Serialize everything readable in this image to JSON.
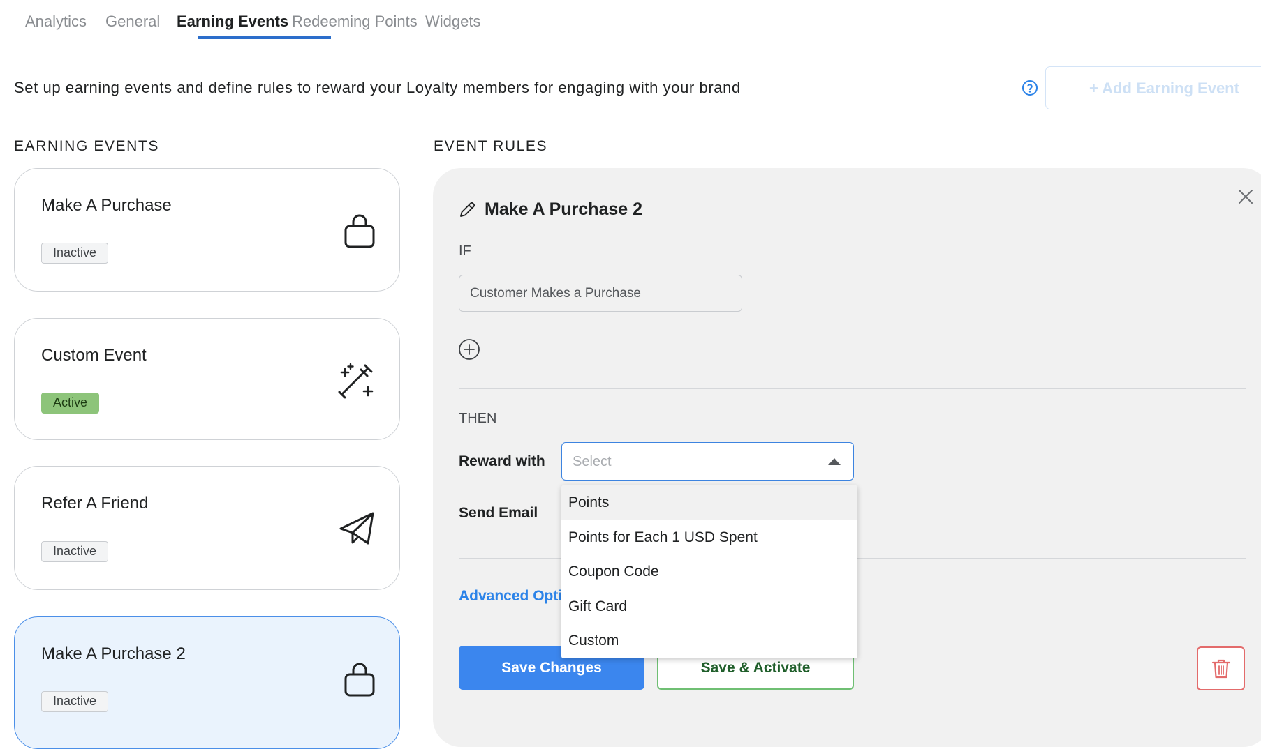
{
  "tabs": [
    {
      "label": "Analytics"
    },
    {
      "label": "General"
    },
    {
      "label": "Earning Events"
    },
    {
      "label": "Redeeming Points"
    },
    {
      "label": "Widgets"
    }
  ],
  "intro_text": "Set up earning events and define rules to reward your Loyalty members for engaging with your brand",
  "add_event_button": "+ Add Earning Event",
  "earning_events": {
    "heading": "EARNING EVENTS",
    "items": [
      {
        "title": "Make A Purchase",
        "status": "Inactive",
        "icon": "shopping-bag-icon"
      },
      {
        "title": "Custom Event",
        "status": "Active",
        "icon": "magic-wand-icon"
      },
      {
        "title": "Refer A Friend",
        "status": "Inactive",
        "icon": "paper-plane-icon"
      },
      {
        "title": "Make A Purchase 2",
        "status": "Inactive",
        "icon": "shopping-bag-icon",
        "selected": true
      }
    ]
  },
  "event_rules": {
    "heading": "EVENT RULES",
    "title": "Make A Purchase 2",
    "if_label": "IF",
    "condition": "Customer Makes a Purchase",
    "then_label": "THEN",
    "reward_label": "Reward with",
    "reward_placeholder": "Select",
    "send_email_label": "Send Email",
    "advanced_options": "Advanced Opti",
    "save_button": "Save Changes",
    "activate_button": "Save & Activate",
    "reward_options": [
      "Points",
      "Points for Each 1 USD Spent",
      "Coupon Code",
      "Gift Card",
      "Custom"
    ]
  },
  "colors": {
    "accent": "#3b86ee",
    "active_badge": "#8dc47a",
    "delete": "#e36b6b",
    "activate_border": "#6fbf73"
  }
}
